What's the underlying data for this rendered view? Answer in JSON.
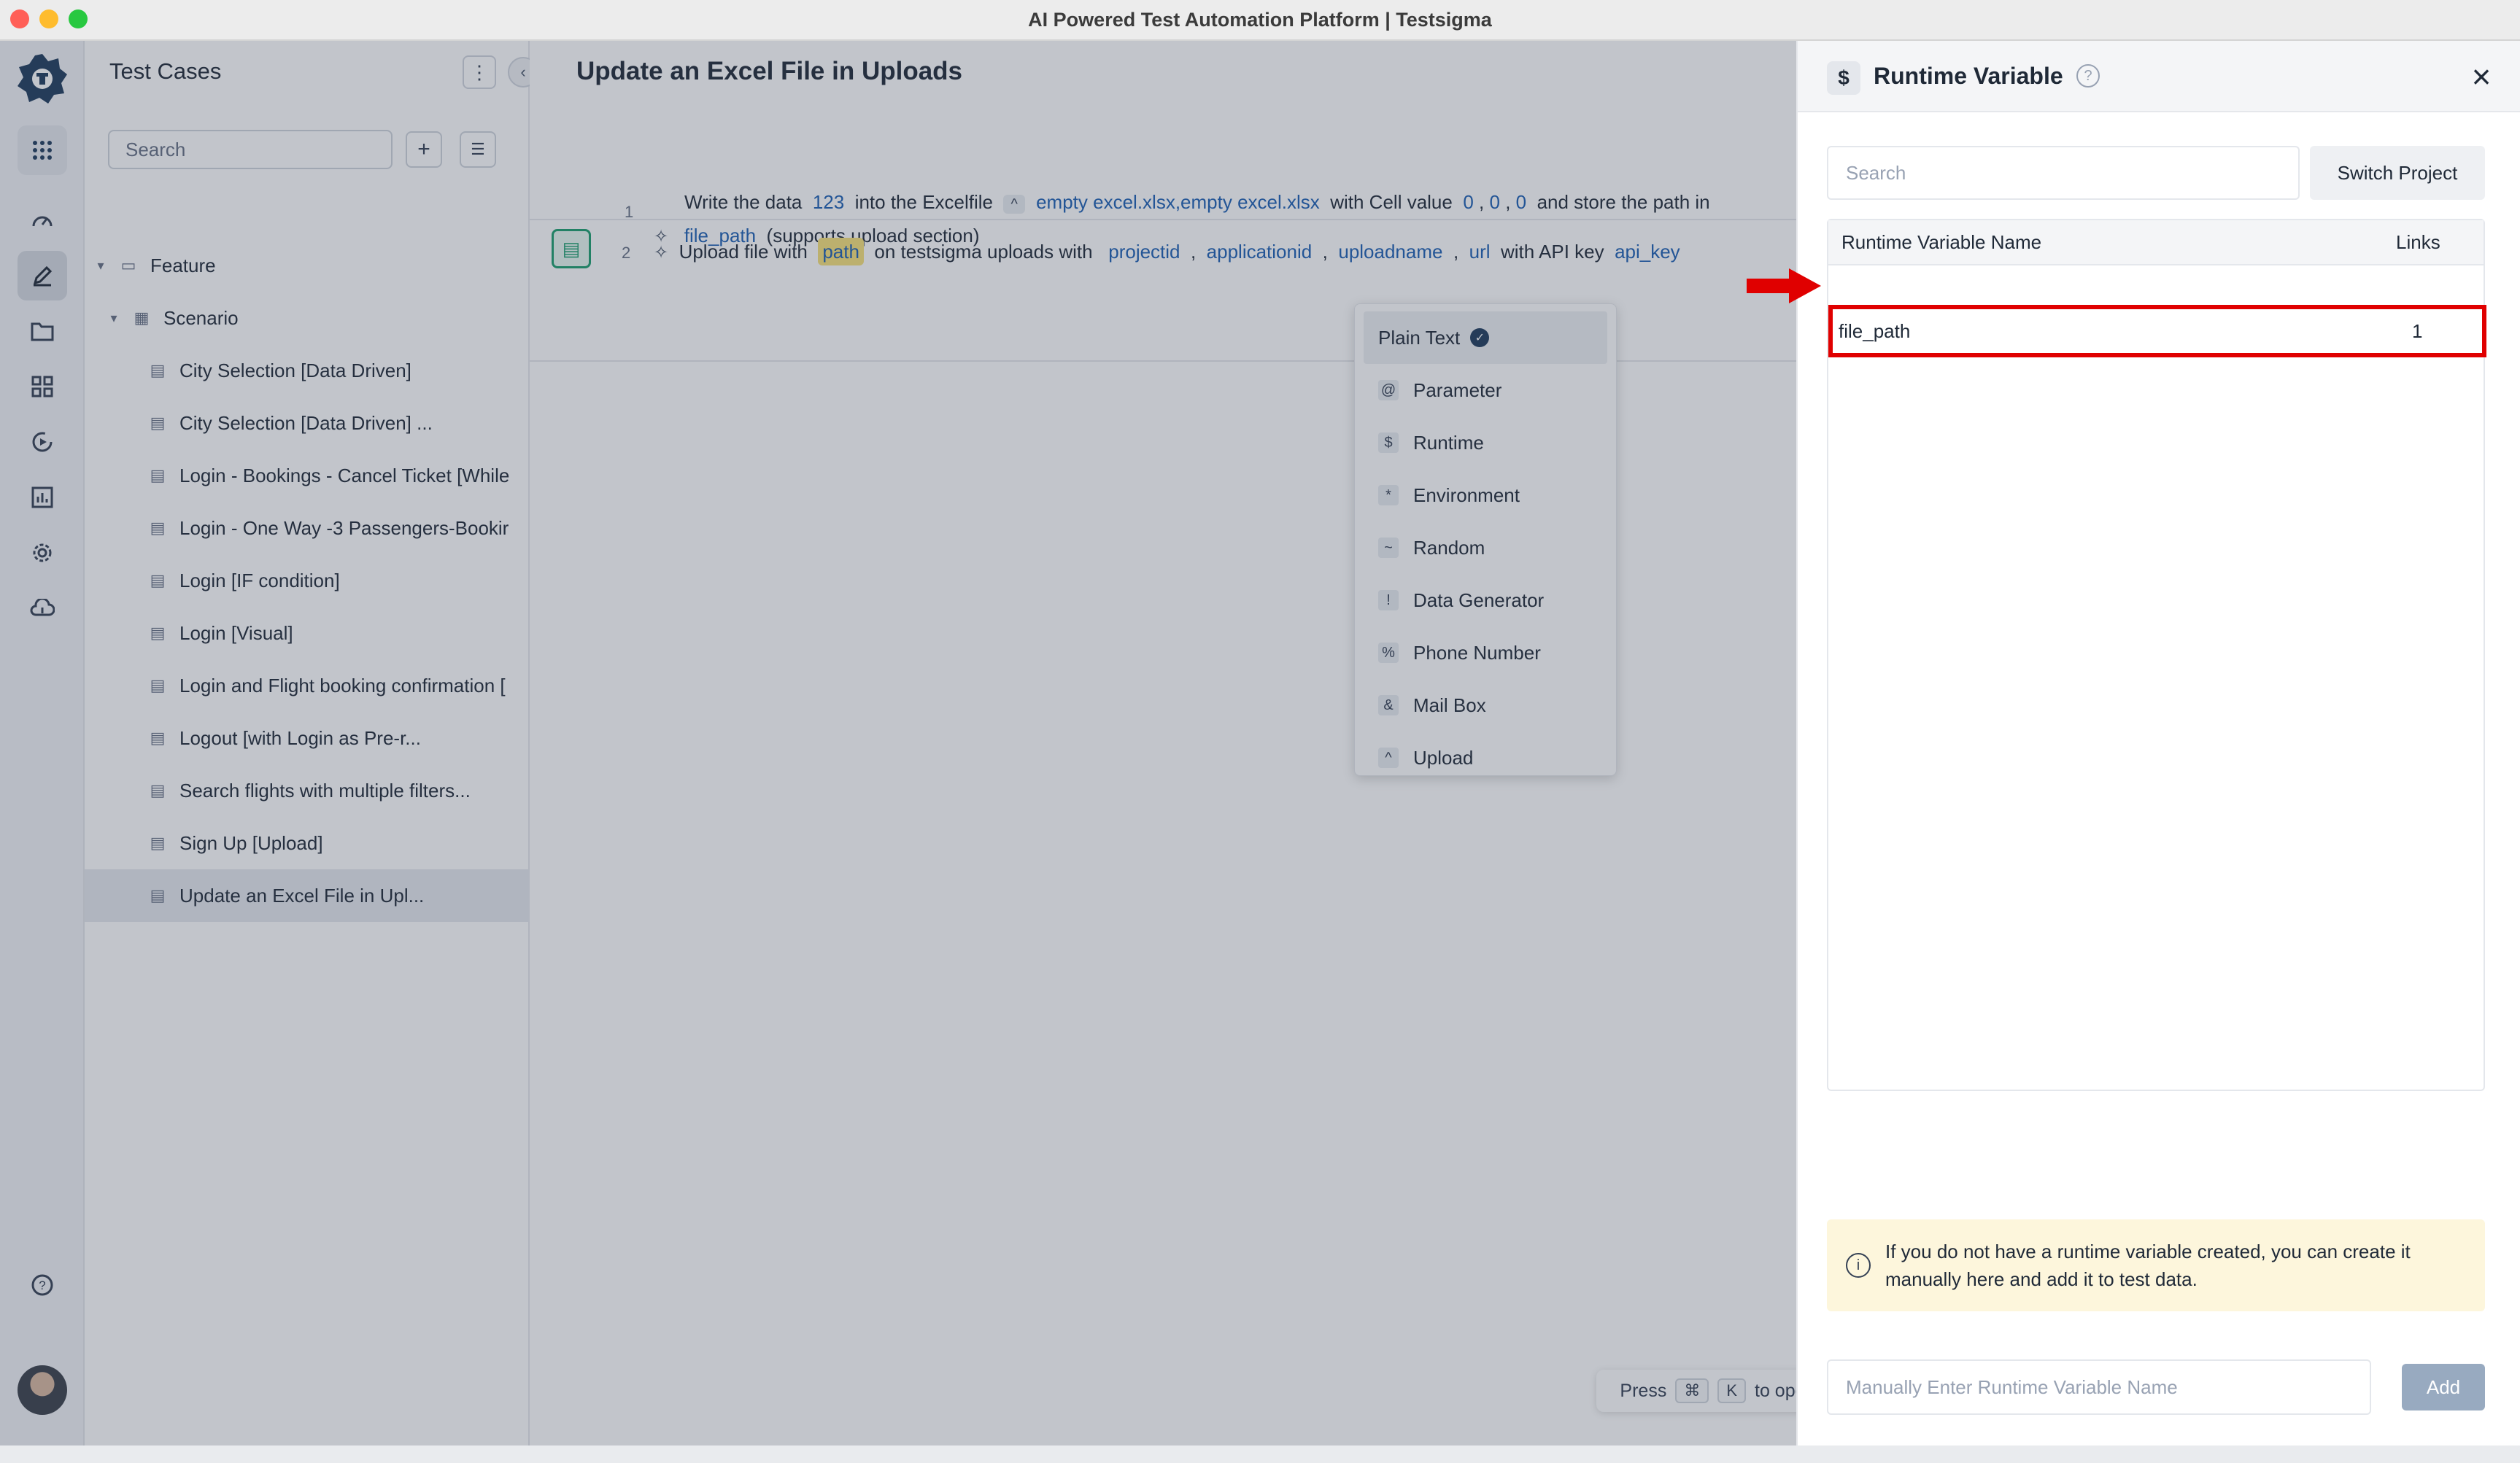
{
  "window": {
    "title": "AI Powered Test Automation Platform | Testsigma"
  },
  "colors": {
    "close": "#ff5f57",
    "minimize": "#febc2e",
    "maximize": "#28c840",
    "brand": "#1f3b5c",
    "link": "#1c5fb3",
    "highlight_border": "#e00000"
  },
  "rail": {
    "icons": [
      "apps-grid-icon",
      "dashboard-icon",
      "edit-icon",
      "folder-icon",
      "modules-icon",
      "run-icon",
      "reports-icon",
      "settings-icon",
      "cloud-icon",
      "help-icon"
    ]
  },
  "sidebar": {
    "title": "Test Cases",
    "search_placeholder": "Search",
    "tree": [
      {
        "label": "Feature",
        "kind": "feature"
      },
      {
        "label": "Scenario",
        "kind": "scenario"
      },
      {
        "label": "City Selection [Data Driven]"
      },
      {
        "label": "City Selection [Data Driven] ..."
      },
      {
        "label": "Login - Bookings - Cancel Ticket [While"
      },
      {
        "label": "Login - One Way -3 Passengers-Bookir"
      },
      {
        "label": "Login [IF condition]"
      },
      {
        "label": "Login [Visual]"
      },
      {
        "label": "Login and Flight booking confirmation ["
      },
      {
        "label": "Logout [with Login as Pre-r..."
      },
      {
        "label": "Search flights with multiple filters..."
      },
      {
        "label": "Sign Up [Upload]"
      },
      {
        "label": "Update an Excel File in Upl..."
      }
    ]
  },
  "editor": {
    "title": "Update an Excel File in Uploads",
    "step1": {
      "num": "1",
      "t1": "Write the data",
      "v1": "123",
      "t2": "into the Excelfile",
      "chip": "^",
      "v2": "empty excel.xlsx,empty excel.xlsx",
      "t3": "with Cell value",
      "v3": "0",
      "comma": ",",
      "v4": "0",
      "v5": "0",
      "t4": "and store the path in",
      "v6": "file_path",
      "t5": "(supports upload section)"
    },
    "step2": {
      "num": "2",
      "t1": "Upload file with",
      "v1": "path",
      "t2": "on testsigma uploads with",
      "v2": "projectid",
      "v3": "applicationid",
      "v4": "uploadname",
      "v5": "url",
      "t3": "with API key",
      "v6": "api_key"
    },
    "dropdown": [
      {
        "symbol": "",
        "label": "Plain Text",
        "selected": true
      },
      {
        "symbol": "@",
        "label": "Parameter"
      },
      {
        "symbol": "$",
        "label": "Runtime"
      },
      {
        "symbol": "*",
        "label": "Environment"
      },
      {
        "symbol": "~",
        "label": "Random"
      },
      {
        "symbol": "!",
        "label": "Data Generator"
      },
      {
        "symbol": "%",
        "label": "Phone Number"
      },
      {
        "symbol": "&",
        "label": "Mail Box"
      },
      {
        "symbol": "^",
        "label": "Upload"
      }
    ],
    "command": {
      "press": "Press",
      "key1": "⌘",
      "key2": "K",
      "text": "to open command center"
    }
  },
  "panel": {
    "symbol": "$",
    "title": "Runtime Variable",
    "search_placeholder": "Search",
    "switch_label": "Switch Project",
    "col_name": "Runtime Variable Name",
    "col_links": "Links",
    "rows": [
      {
        "name": "file_path",
        "links": "1"
      }
    ],
    "info_text": "If you do not have a runtime variable created, you can create it manually here and add it to test data.",
    "input_placeholder": "Manually Enter Runtime Variable Name",
    "add_label": "Add"
  }
}
